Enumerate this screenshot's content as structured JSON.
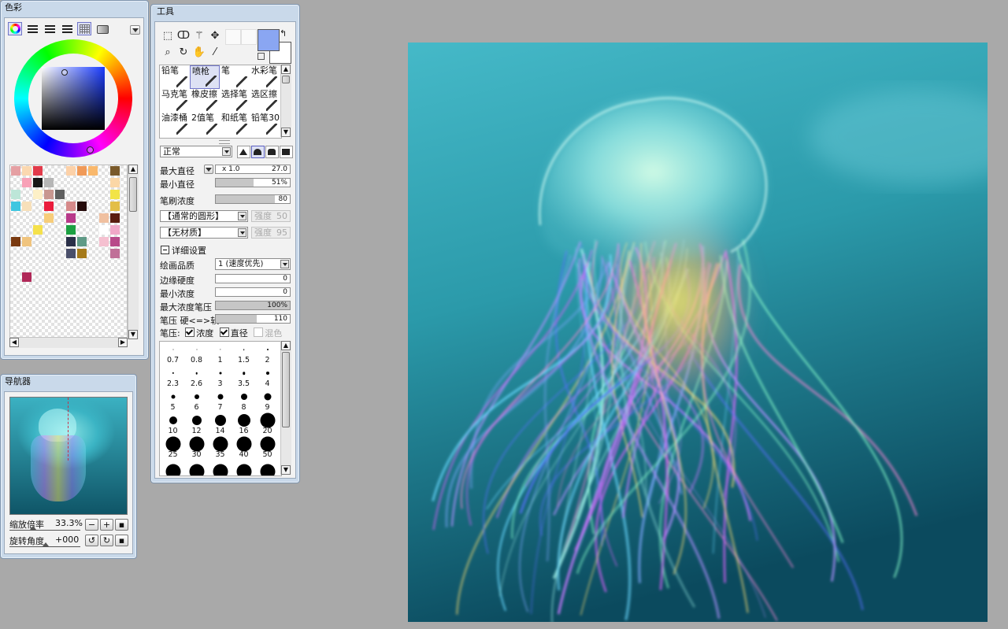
{
  "color_panel": {
    "title": "色彩",
    "mode_icons": [
      "color-wheel-icon",
      "rgb-slider-icon",
      "hsv-slider-icon",
      "list-slider-icon",
      "swatch-grid-icon",
      "scratchpad-icon"
    ],
    "hue_color": "#1a3cff",
    "swatches": [
      [
        "#e5a0a3",
        "#fbd8b0",
        "#e23a4a",
        "",
        "",
        "#fcd1a8",
        "#f09a58",
        "#f9b86c",
        "",
        "#7a5a2a",
        ""
      ],
      [
        "",
        "#f8a1b7",
        "#171717",
        "#b6b6b6",
        "",
        "",
        "",
        "",
        "",
        "#fbd7a6",
        ""
      ],
      [
        "#bde6d8",
        "",
        "#fdf0c7",
        "#c89790",
        "#5f5f5f",
        "",
        "",
        "",
        "",
        "#f2e447",
        ""
      ],
      [
        "#3fc6e0",
        "#f7e0ba",
        "",
        "#ea1d3d",
        "",
        "#d68a8a",
        "#250a0a",
        "",
        "",
        "#e3be47",
        ""
      ],
      [
        "",
        "",
        "",
        "#f7cd7a",
        "",
        "#b83a8a",
        "",
        "",
        "#f0c0a0",
        "#5a1d10",
        ""
      ],
      [
        "",
        "",
        "#f5e14b",
        "",
        "",
        "#1ca042",
        "",
        "",
        "#ffffff",
        "#f0a8c8",
        ""
      ],
      [
        "#7a3a10",
        "#f0c47e",
        "",
        "",
        "",
        "#2a2f48",
        "#5f9a86",
        "",
        "#f5c0d0",
        "#b84a8a",
        ""
      ],
      [
        "",
        "",
        "",
        "",
        "",
        "#4a4f6a",
        "#a57a1a",
        "",
        "",
        "#c07098",
        ""
      ],
      [
        "",
        "",
        "",
        "",
        "",
        "",
        "",
        "",
        "",
        "",
        ""
      ],
      [
        "",
        "#b02858",
        "",
        "",
        "",
        "",
        "",
        "",
        "",
        "",
        ""
      ]
    ]
  },
  "navigator": {
    "title": "导航器",
    "zoom_label": "缩放倍率",
    "zoom_value": "33.3%",
    "rotate_label": "旋转角度",
    "rotate_value": "+000"
  },
  "tools_panel": {
    "title": "工具",
    "fg_color": "#8aa6f2",
    "bg_color": "#ffffff",
    "selection_tools": [
      "rect-select-icon",
      "lasso-icon",
      "magic-wand-icon",
      "move-icon",
      "zoom-icon",
      "rotate-icon",
      "hand-icon",
      "eyedropper-icon"
    ],
    "brushes": [
      {
        "label": "铅笔",
        "icon": "pencil-icon"
      },
      {
        "label": "喷枪",
        "icon": "airbrush-icon"
      },
      {
        "label": "笔",
        "icon": "pen-icon"
      },
      {
        "label": "水彩笔",
        "icon": "watercolor-icon"
      },
      {
        "label": "马克笔",
        "icon": "marker-icon"
      },
      {
        "label": "橡皮擦",
        "icon": "eraser-icon"
      },
      {
        "label": "选择笔",
        "icon": "select-pen-icon"
      },
      {
        "label": "选区擦",
        "icon": "select-eraser-icon"
      },
      {
        "label": "油漆桶",
        "icon": "bucket-icon"
      },
      {
        "label": "2值笔",
        "icon": "binary-pen-icon"
      },
      {
        "label": "和纸笔",
        "icon": "washi-pen-icon"
      },
      {
        "label": "铅笔30",
        "icon": "pencil-icon"
      }
    ],
    "blend_mode": "正常",
    "max_diameter_label": "最大直径",
    "max_diameter_mult": "x 1.0",
    "max_diameter_value": "27.0",
    "min_diameter_label": "最小直径",
    "min_diameter_value": "51%",
    "min_diameter_fill": 0.51,
    "density_label": "笔刷浓度",
    "density_value": "80",
    "density_fill": 0.8,
    "shape_value": "【通常的圆形】",
    "shape_strength_label": "强度",
    "shape_strength_value": "50",
    "texture_value": "【无材质】",
    "texture_strength_label": "强度",
    "texture_strength_value": "95",
    "detail_label": "详细设置",
    "quality_label": "绘画品质",
    "quality_value": "1 (速度优先)",
    "edge_label": "边缘硬度",
    "edge_value": "0",
    "min_density_label": "最小浓度",
    "min_density_value": "0",
    "max_pressure_label": "最大浓度笔压",
    "max_pressure_value": "100%",
    "max_pressure_fill": 1.0,
    "pressure_label": "笔压 硬<=>软",
    "pressure_value": "110",
    "pressure_fill": 0.55,
    "pressure_opts_label": "笔压:",
    "opt_density": "浓度",
    "opt_diameter": "直径",
    "opt_blend": "混色",
    "brush_sizes": [
      "0.7",
      "0.8",
      "1",
      "1.5",
      "2",
      "2.3",
      "2.6",
      "3",
      "3.5",
      "4",
      "5",
      "6",
      "7",
      "8",
      "9",
      "10",
      "12",
      "14",
      "16",
      "20",
      "25",
      "30",
      "35",
      "40",
      "50",
      "",
      "",
      "",
      "",
      ""
    ]
  },
  "canvas": {
    "bg_top": "#3fb2c4",
    "bg_bottom": "#0e4d60"
  }
}
